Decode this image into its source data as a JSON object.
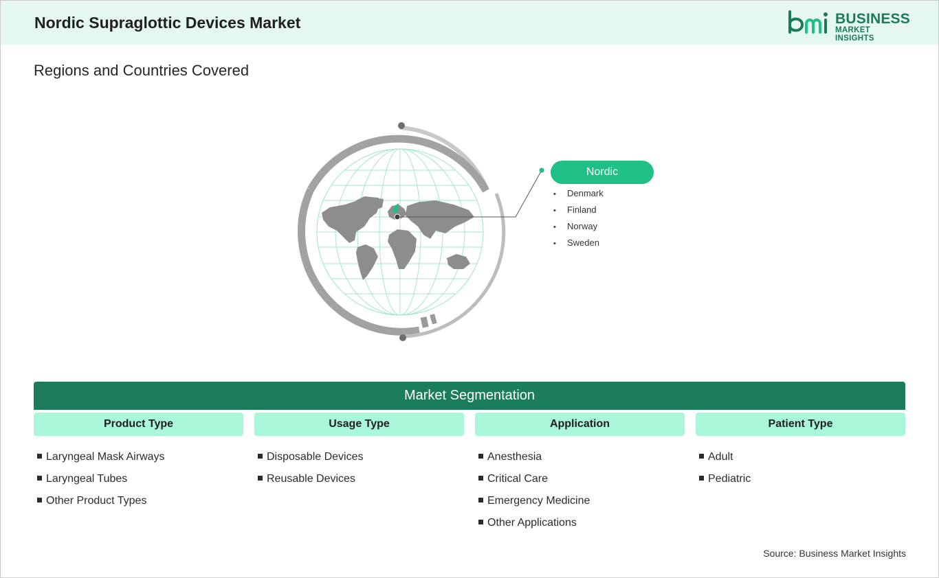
{
  "header": {
    "title": "Nordic Supraglottic Devices Market",
    "logo": {
      "line1": "BUSINESS",
      "line2": "MARKET INSIGHTS",
      "color": "#1a7a5b"
    }
  },
  "regions": {
    "title": "Regions and Countries Covered",
    "region_name": "Nordic",
    "countries": [
      "Denmark",
      "Finland",
      "Norway",
      "Sweden"
    ]
  },
  "segmentation": {
    "title": "Market Segmentation",
    "columns": [
      {
        "heading": "Product Type",
        "items": [
          "Laryngeal Mask Airways",
          "Laryngeal Tubes",
          "Other Product Types"
        ]
      },
      {
        "heading": "Usage Type",
        "items": [
          "Disposable Devices",
          "Reusable Devices"
        ]
      },
      {
        "heading": "Application",
        "items": [
          "Anesthesia",
          "Critical Care",
          "Emergency Medicine",
          "Other Applications"
        ]
      },
      {
        "heading": "Patient Type",
        "items": [
          "Adult",
          "Pediatric"
        ]
      }
    ]
  },
  "source": "Source: Business Market Insights",
  "colors": {
    "header_bg": "#e4f8ef",
    "accent": "#1fbf86",
    "banner": "#1b7d5c",
    "column_head": "#aaf6d8",
    "globe_ring": "#a9a9a9"
  }
}
